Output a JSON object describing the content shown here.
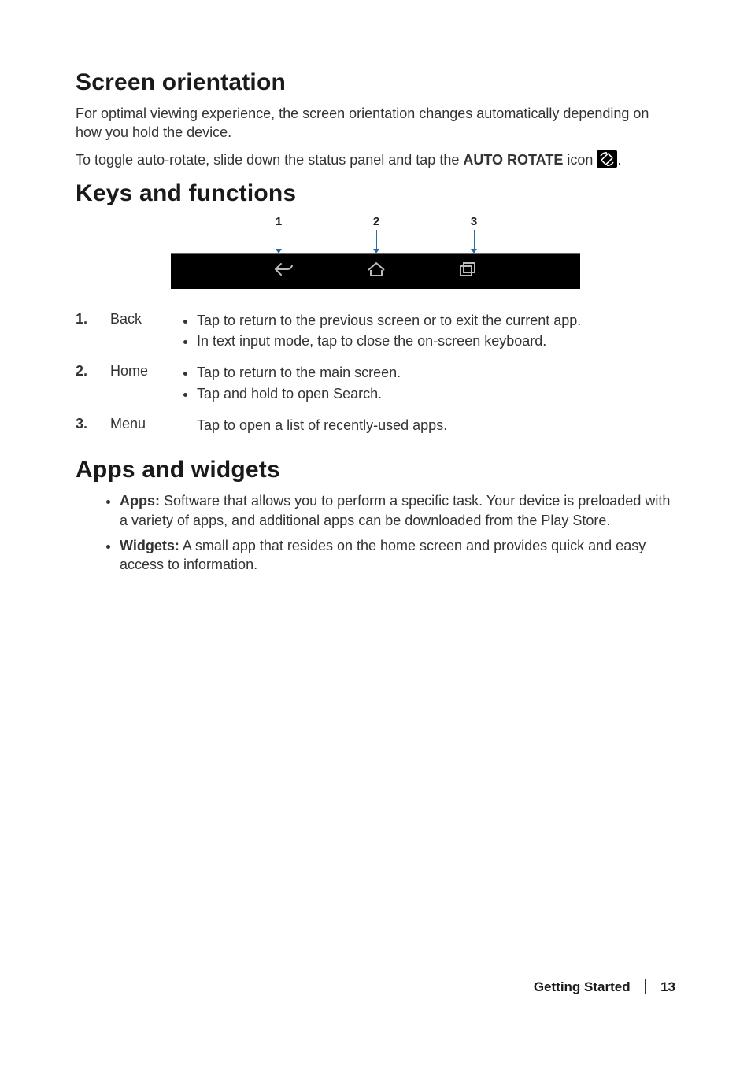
{
  "sections": {
    "orientation": {
      "title": "Screen orientation",
      "para1": "For optimal viewing experience, the screen orientation changes automatically depending on how you hold the device.",
      "para2_prefix": "To toggle auto-rotate, slide down the status panel and tap the ",
      "para2_bold": "AUTO ROTATE",
      "para2_after_bold": " icon ",
      "para2_suffix": "."
    },
    "keys": {
      "title": "Keys and functions",
      "callouts": [
        "1",
        "2",
        "3"
      ],
      "rows": [
        {
          "num": "1.",
          "label": "Back",
          "bullets": [
            "Tap to return to the previous screen or to exit the current app.",
            "In text input mode, tap to close the on-screen keyboard."
          ]
        },
        {
          "num": "2.",
          "label": "Home",
          "bullets": [
            "Tap to return to the main screen.",
            "Tap and hold to open Search."
          ]
        },
        {
          "num": "3.",
          "label": "Menu",
          "single": "Tap to open a list of recently-used apps."
        }
      ]
    },
    "apps": {
      "title": "Apps and widgets",
      "items": [
        {
          "term": "Apps:",
          "text": " Software that allows you to perform a specific task. Your device is preloaded with a variety of apps, and additional apps can be downloaded from the Play Store."
        },
        {
          "term": "Widgets:",
          "text": " A small app that resides on the home screen and provides quick and easy access to information."
        }
      ]
    }
  },
  "footer": {
    "chapter": "Getting Started",
    "page": "13"
  }
}
